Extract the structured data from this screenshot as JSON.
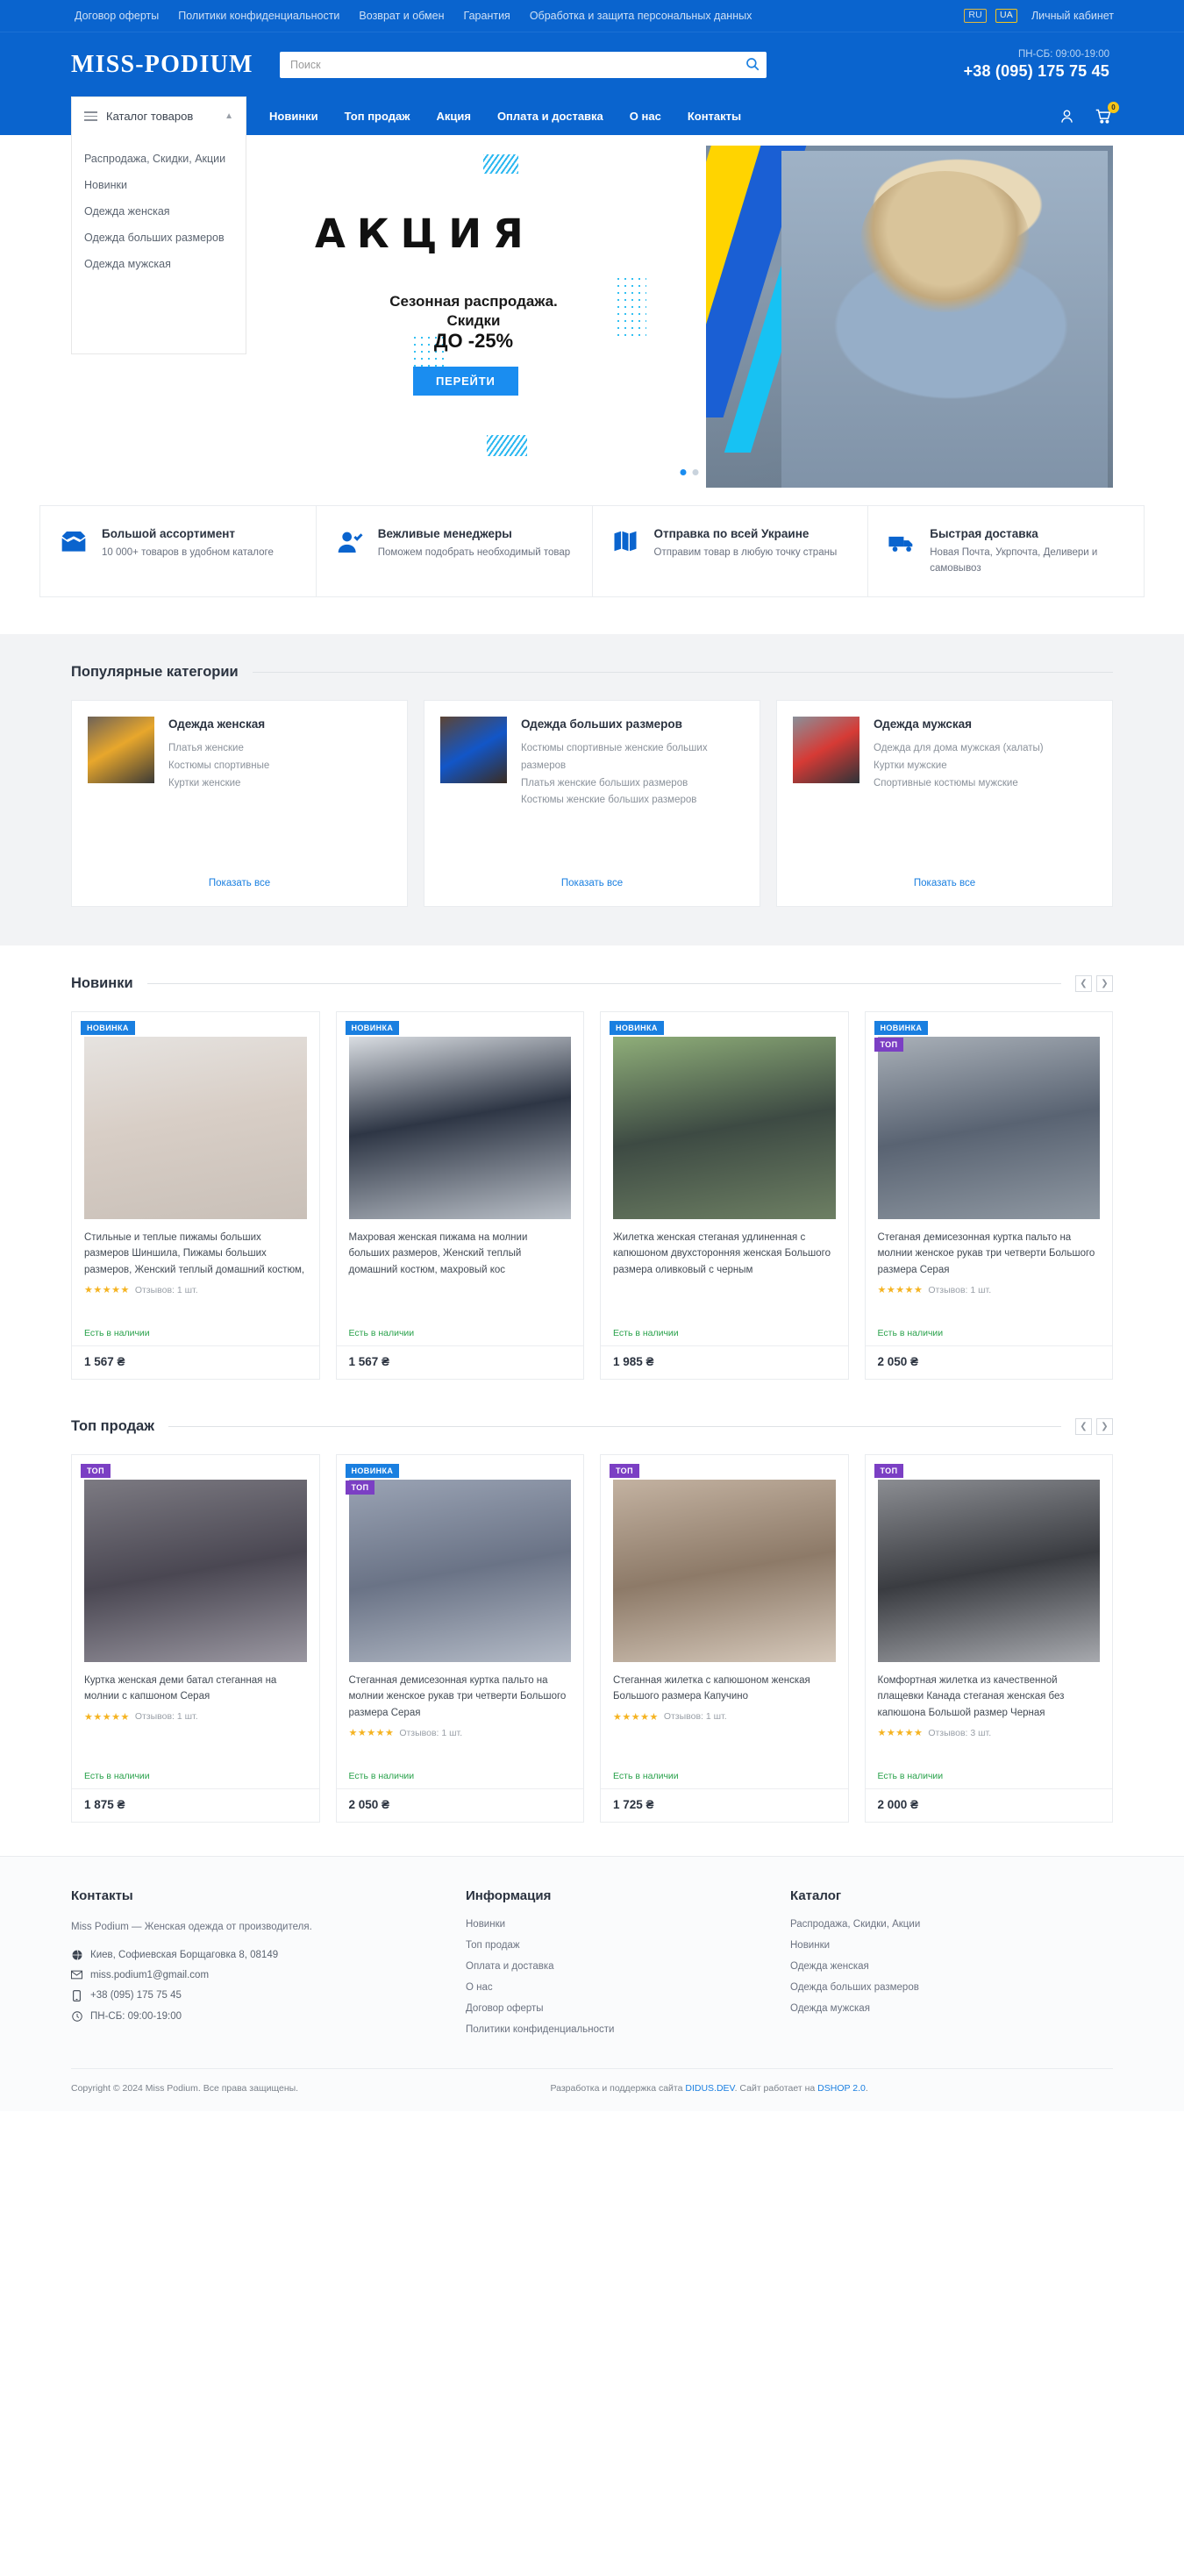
{
  "topbar": {
    "links": [
      "Договор оферты",
      "Политики конфиденциальности",
      "Возврат и обмен",
      "Гарантия",
      "Обработка и защита персональных данных"
    ],
    "lang_ru": "RU",
    "lang_ua": "UA",
    "cabinet": "Личный кабинет"
  },
  "header": {
    "logo": "MISS-PODIUM",
    "search_placeholder": "Поиск",
    "search_value": "",
    "work_hours": "ПН-СБ: 09:00-19:00",
    "phone": "+38 (095) 175 75 45"
  },
  "nav": {
    "catalog_label": "Каталог товаров",
    "links": [
      "Новинки",
      "Топ продаж",
      "Акция",
      "Оплата и доставка",
      "О нас",
      "Контакты"
    ],
    "cart_count": "0",
    "catalog_items": [
      "Распродажа, Скидки, Акции",
      "Новинки",
      "Одежда женская",
      "Одежда больших размеров",
      "Одежда мужская"
    ]
  },
  "banner": {
    "headline": "АКЦИЯ",
    "line1": "Сезонная распродажа.",
    "line2": "Скидки",
    "line3": "ДО -25%",
    "button": "ПЕРЕЙТИ",
    "slide_index": 1,
    "slides_total": 2
  },
  "features": [
    {
      "icon": "box-icon",
      "title": "Большой ассортимент",
      "desc": "10 000+ товаров в удобном каталоге"
    },
    {
      "icon": "user-check-icon",
      "title": "Вежливые менеджеры",
      "desc": "Поможем подобрать необходимый товар"
    },
    {
      "icon": "map-icon",
      "title": "Отправка по всей Украине",
      "desc": "Отправим товар в любую точку страны"
    },
    {
      "icon": "truck-icon",
      "title": "Быстрая доставка",
      "desc": "Новая Почта, Укрпочта, Деливери и самовывоз"
    }
  ],
  "categories_section": {
    "title": "Популярные категории",
    "show_all": "Показать все",
    "items": [
      {
        "name": "Одежда женская",
        "subs": [
          "Платья женские",
          "Костюмы спортивные",
          "Куртки женские"
        ]
      },
      {
        "name": "Одежда больших размеров",
        "subs": [
          "Костюмы спортивные женские больших размеров",
          "Платья женские больших размеров",
          "Костюмы женские больших размеров"
        ]
      },
      {
        "name": "Одежда мужская",
        "subs": [
          "Одежда для дома мужская (халаты)",
          "Куртки мужские",
          "Спортивные костюмы мужские"
        ]
      }
    ]
  },
  "new_section": {
    "title": "Новинки",
    "products": [
      {
        "badges": [
          "НОВИНКА"
        ],
        "title": "Стильные и теплые пижамы больших размеров Шиншила, Пижамы больших размеров, Женский теплый домашний костюм,",
        "stars": "★★★★★",
        "reviews": "Отзывов: 1 шт.",
        "stock": "Есть в наличии",
        "price": "1 567 ₴"
      },
      {
        "badges": [
          "НОВИНКА"
        ],
        "title": "Махровая женская пижама на молнии больших размеров, Женский теплый домашний костюм, махровый кос",
        "stars": "",
        "reviews": "",
        "stock": "Есть в наличии",
        "price": "1 567 ₴"
      },
      {
        "badges": [
          "НОВИНКА"
        ],
        "title": "Жилетка женская стеганая удлиненная с капюшоном двухсторонняя женская Большого размера оливковый с черным",
        "stars": "",
        "reviews": "",
        "stock": "Есть в наличии",
        "price": "1 985 ₴"
      },
      {
        "badges": [
          "НОВИНКА",
          "ТОП"
        ],
        "title": "Стеганая демисезонная куртка пальто на молнии женское рукав три четверти Большого размера Серая",
        "stars": "★★★★★",
        "reviews": "Отзывов: 1 шт.",
        "stock": "Есть в наличии",
        "price": "2 050 ₴"
      }
    ]
  },
  "top_section": {
    "title": "Топ продаж",
    "products": [
      {
        "badges": [
          "ТОП"
        ],
        "title": "Куртка женская деми батал стеганная на молнии с капшоном Серая",
        "stars": "★★★★★",
        "reviews": "Отзывов: 1 шт.",
        "stock": "Есть в наличии",
        "price": "1 875 ₴"
      },
      {
        "badges": [
          "НОВИНКА",
          "ТОП"
        ],
        "title": "Стеганная демисезонная куртка пальто на молнии женское рукав три четверти Большого размера Серая",
        "stars": "★★★★★",
        "reviews": "Отзывов: 1 шт.",
        "stock": "Есть в наличии",
        "price": "2 050 ₴"
      },
      {
        "badges": [
          "ТОП"
        ],
        "title": "Стеганная жилетка с капюшоном женская Большого размера Капучино",
        "stars": "★★★★★",
        "reviews": "Отзывов: 1 шт.",
        "stock": "Есть в наличии",
        "price": "1 725 ₴"
      },
      {
        "badges": [
          "ТОП"
        ],
        "title": "Комфортная жилетка из качественной плащевки Канада стеганая женская без капюшона Большой размер Черная",
        "stars": "★★★★★",
        "reviews": "Отзывов: 3 шт.",
        "stock": "Есть в наличии",
        "price": "2 000 ₴"
      }
    ]
  },
  "footer": {
    "contacts": {
      "head": "Контакты",
      "about": "Miss Podium — Женская одежда от производителя.",
      "address": "Киев, Софиевская Борщаговка 8, 08149",
      "email": "miss.podium1@gmail.com",
      "phone": "+38 (095) 175 75 45",
      "hours": "ПН-СБ: 09:00-19:00"
    },
    "info": {
      "head": "Информация",
      "items": [
        "Новинки",
        "Топ продаж",
        "Оплата и доставка",
        "О нас",
        "Договор оферты",
        "Политики конфиденциальности"
      ]
    },
    "catalog": {
      "head": "Каталог",
      "items": [
        "Распродажа, Скидки, Акции",
        "Новинки",
        "Одежда женская",
        "Одежда больших размеров",
        "Одежда мужская"
      ]
    },
    "copyright": "Copyright © 2024 Miss Podium. Все права защищены.",
    "dev_prefix": "Разработка и поддержка сайта ",
    "dev_name": "DIDUS.DEV",
    "dev_mid": ". Сайт работает на ",
    "dev_engine": "DSHOP 2.0",
    "dev_suffix": "."
  },
  "colors": {
    "brand_blue": "#0a64ce",
    "accent_blue": "#1a8df0",
    "badge_top": "#7b3fc4",
    "star": "#f5b321",
    "stock_green": "#2aa24c",
    "lang_border": "#f5c518"
  }
}
